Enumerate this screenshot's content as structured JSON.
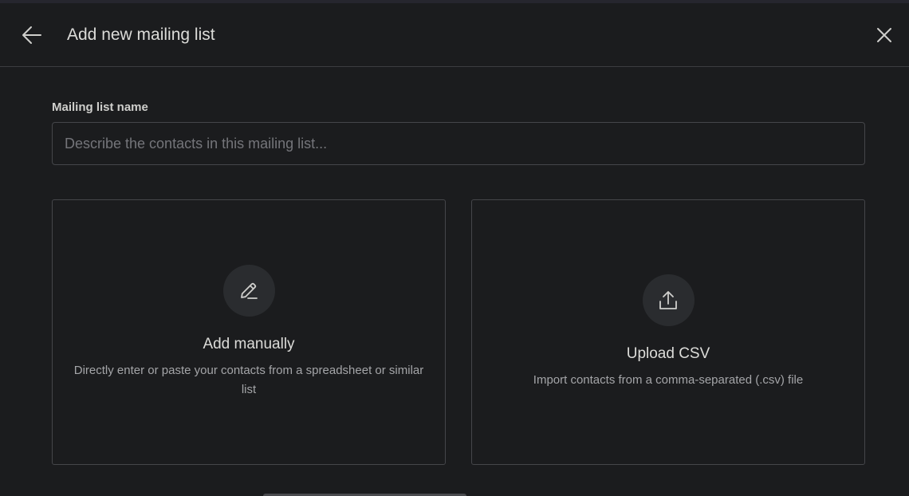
{
  "header": {
    "title": "Add new mailing list",
    "back_icon": "arrow-left-icon",
    "close_icon": "close-icon"
  },
  "form": {
    "name_label": "Mailing list name",
    "name_placeholder": "Describe the contacts in this mailing list...",
    "name_value": ""
  },
  "options": [
    {
      "icon": "pencil-icon",
      "title": "Add manually",
      "description": "Directly enter or paste your contacts from a spreadsheet or similar list"
    },
    {
      "icon": "upload-icon",
      "title": "Upload CSV",
      "description": "Import contacts from a comma-separated (.csv) file"
    }
  ],
  "colors": {
    "background": "#1b1c1e",
    "border": "#45464a",
    "icon_circle": "#2a2c2f",
    "text_primary": "#dcdcd9",
    "text_secondary": "#a4a5a8"
  }
}
